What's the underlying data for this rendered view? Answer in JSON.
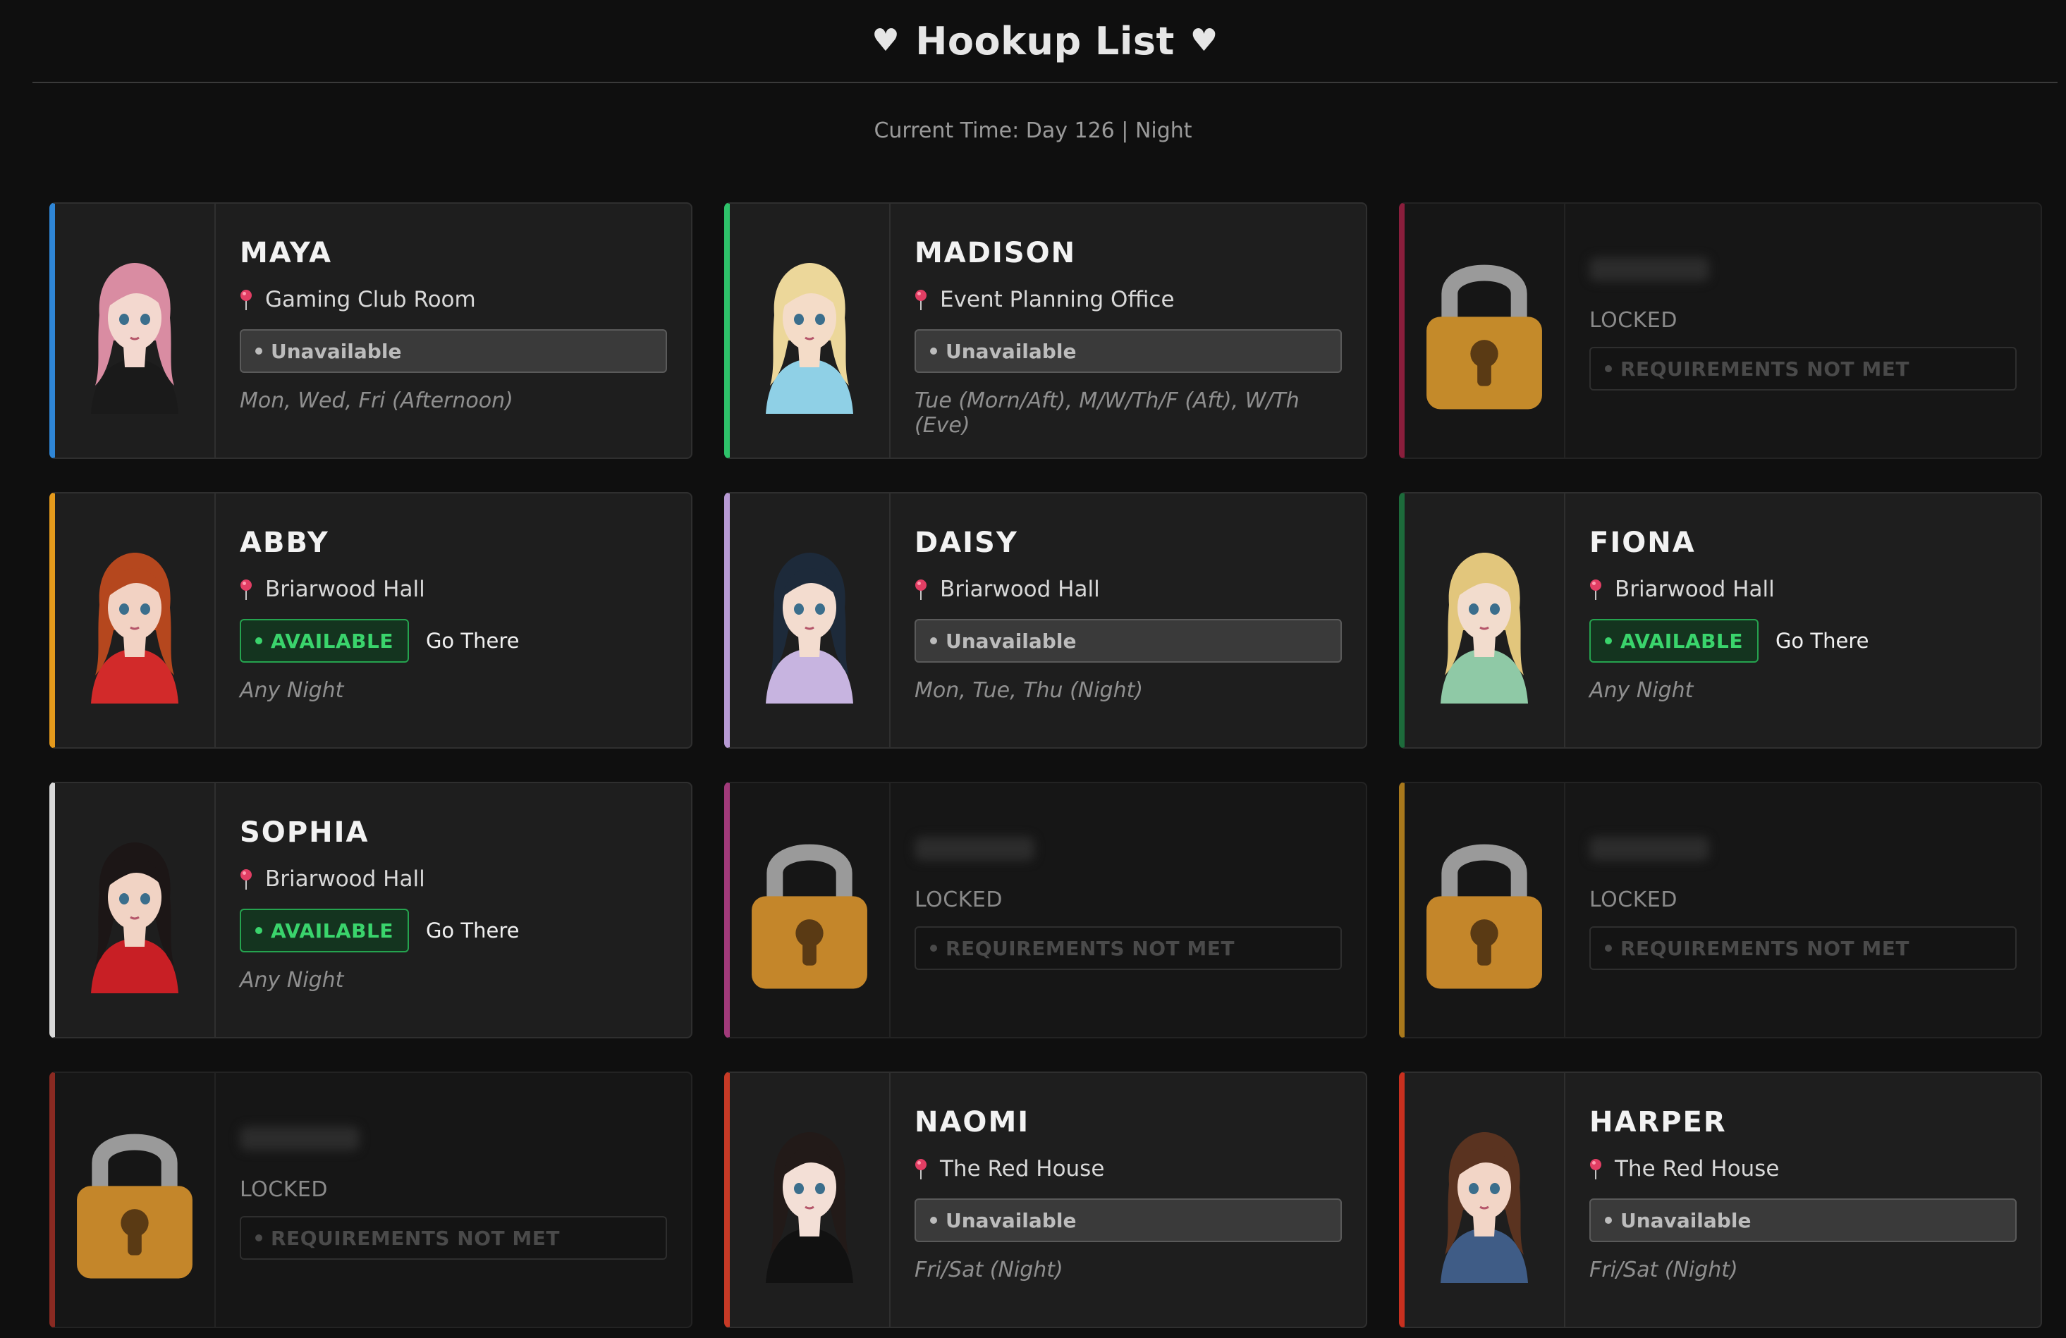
{
  "header": {
    "title": "Hookup List",
    "heart_glyph": "♥"
  },
  "time": "Current Time: Day 126 | Night",
  "labels": {
    "go_there": "Go There",
    "locked": "LOCKED",
    "requirements": "REQUIREMENTS NOT MET",
    "available": "AVAILABLE",
    "unavailable": "Unavailable"
  },
  "characters": [
    {
      "name": "MAYA",
      "accent": "#2f86d6",
      "locked": false,
      "location": "Gaming Club Room",
      "status": "Unavailable",
      "schedule": "Mon, Wed, Fri (Afternoon)",
      "hair": "#d98ca2",
      "skin": "#f3d8cf",
      "outfit": "#1a1a1a"
    },
    {
      "name": "MADISON",
      "accent": "#2ec26a",
      "locked": false,
      "location": "Event Planning Office",
      "status": "Unavailable",
      "schedule": "Tue (Morn/Aft), M/W/Th/F (Aft), W/Th (Eve)",
      "hair": "#ecd79a",
      "skin": "#f4dcc8",
      "outfit": "#8fd0e6"
    },
    {
      "locked": true,
      "accent": "#8a1e3c",
      "lock_color": "#c48a2a"
    },
    {
      "name": "ABBY",
      "accent": "#e59a1c",
      "locked": false,
      "location": "Briarwood Hall",
      "status": "AVAILABLE",
      "schedule": "Any Night",
      "hair": "#b5471e",
      "skin": "#f2d2c3",
      "outfit": "#d22a2a"
    },
    {
      "name": "DAISY",
      "accent": "#b79ad4",
      "locked": false,
      "location": "Briarwood Hall",
      "status": "Unavailable",
      "schedule": "Mon, Tue, Thu (Night)",
      "hair": "#1d2a3a",
      "skin": "#f3dccf",
      "outfit": "#c7b4e0"
    },
    {
      "name": "FIONA",
      "accent": "#1d6b3b",
      "locked": false,
      "location": "Briarwood Hall",
      "status": "AVAILABLE",
      "schedule": "Any Night",
      "hair": "#e2c67c",
      "skin": "#f2dccd",
      "outfit": "#8fc9a6"
    },
    {
      "name": "SOPHIA",
      "accent": "#d9d9d9",
      "locked": false,
      "location": "Briarwood Hall",
      "status": "AVAILABLE",
      "schedule": "Any Night",
      "hair": "#1c1616",
      "skin": "#f1d3c4",
      "outfit": "#c81f25"
    },
    {
      "locked": true,
      "accent": "#a13a7a",
      "lock_color": "#c4862a"
    },
    {
      "locked": true,
      "accent": "#a8781c",
      "lock_color": "#c4862a"
    },
    {
      "locked": true,
      "accent": "#8a2a22",
      "lock_color": "#c4862a"
    },
    {
      "name": "NAOMI",
      "accent": "#c73a26",
      "locked": false,
      "location": "The Red House",
      "status": "Unavailable",
      "schedule": "Fri/Sat (Night)",
      "hair": "#221a18",
      "skin": "#f3dfd6",
      "outfit": "#111111"
    },
    {
      "name": "HARPER",
      "accent": "#c8301f",
      "locked": false,
      "location": "The Red House",
      "status": "Unavailable",
      "schedule": "Fri/Sat (Night)",
      "hair": "#5a3320",
      "skin": "#f2d5c6",
      "outfit": "#3f5c86"
    }
  ]
}
